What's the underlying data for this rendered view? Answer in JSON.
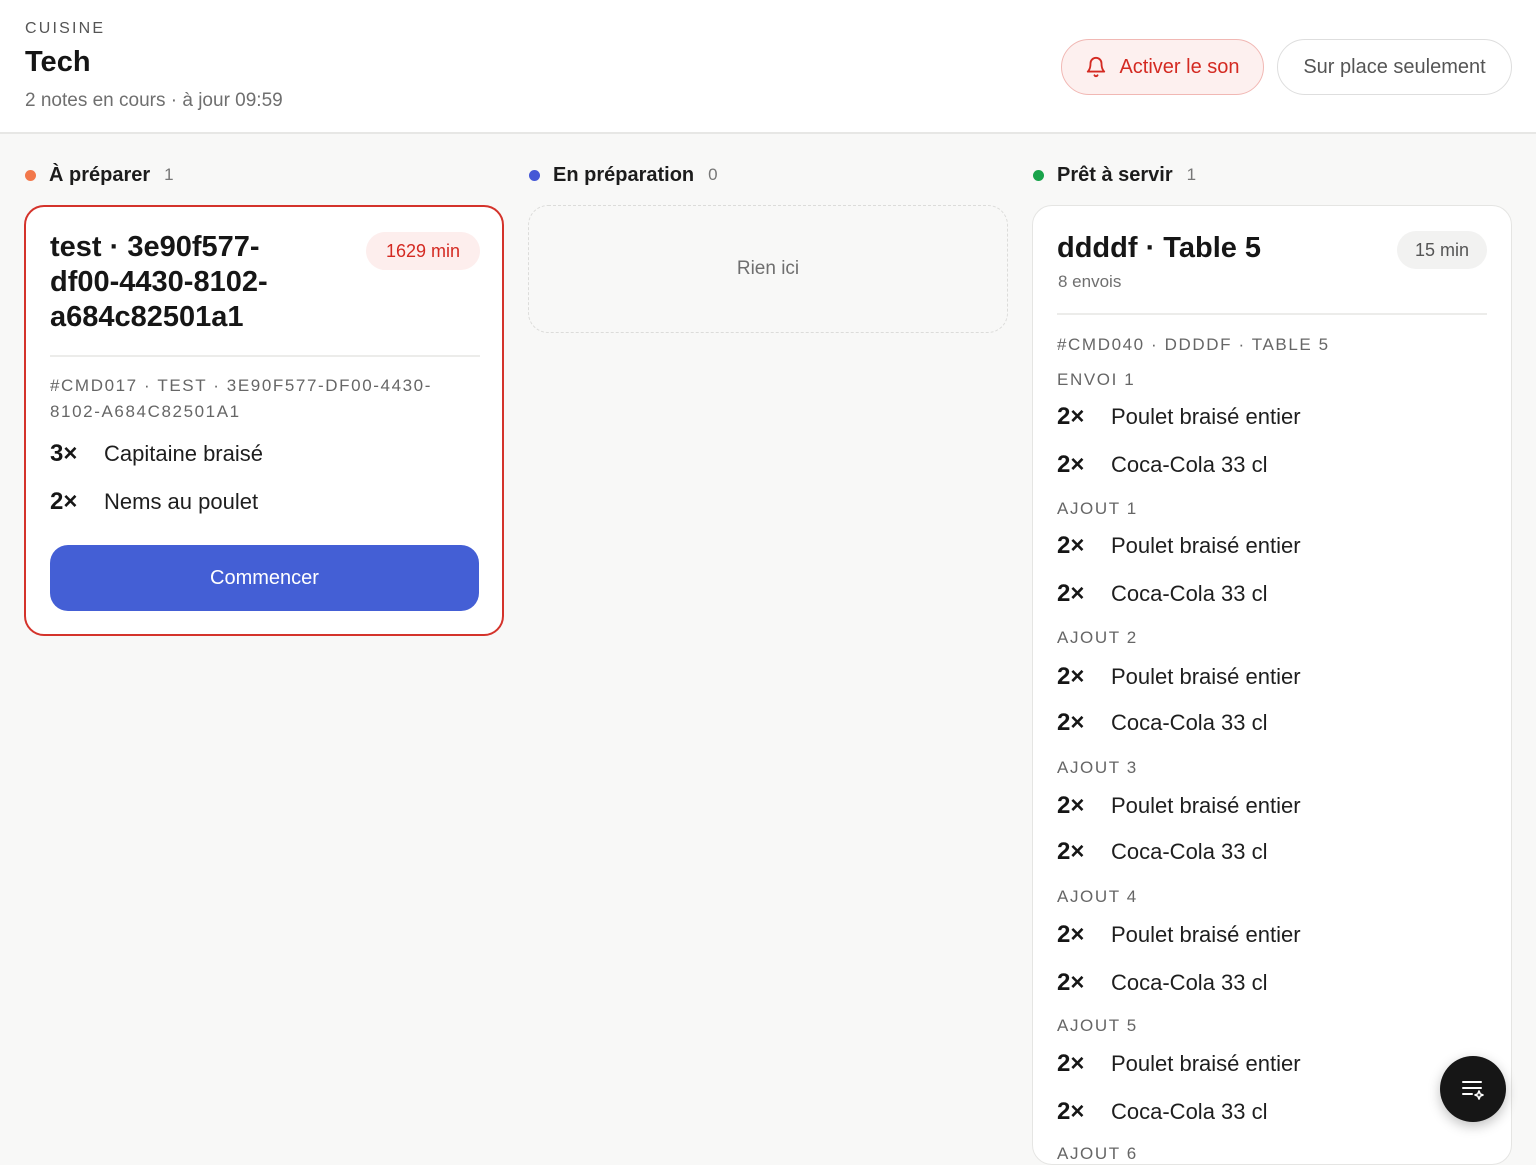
{
  "header": {
    "kicker": "CUISINE",
    "title": "Tech",
    "subtitle": "2 notes en cours · à jour 09:59",
    "sound_button": "Activer le son",
    "onsite_button": "Sur place seulement"
  },
  "colors": {
    "todo": "#f2784b",
    "in_progress": "#4558d6",
    "ready": "#19a34a",
    "late": "#d42a22",
    "primary": "#445fd5"
  },
  "columns": [
    {
      "title": "À préparer",
      "count": "1"
    },
    {
      "title": "En préparation",
      "count": "0"
    },
    {
      "title": "Prêt à servir",
      "count": "1"
    }
  ],
  "todo_card": {
    "title_line1": "test · 3e90f577-",
    "title_line2": "df00-4430-8102-",
    "title_line3": "a684c82501a1",
    "elapsed": "1629 min",
    "ref_line1": "#CMD017 · TEST · 3E90F577-DF00-4430-",
    "ref_line2": "8102-A684C82501A1",
    "items": [
      {
        "qty": "3×",
        "name": "Capitaine braisé"
      },
      {
        "qty": "2×",
        "name": "Nems au poulet"
      }
    ],
    "action": "Commencer"
  },
  "empty_text": "Rien ici",
  "ready_card": {
    "title": "ddddf · Table 5",
    "meta": "8 envois",
    "elapsed": "15 min",
    "ref": "#CMD040 · DDDDF · TABLE 5",
    "groups": [
      {
        "label": "ENVOI 1",
        "items": [
          {
            "qty": "2×",
            "name": "Poulet braisé entier"
          },
          {
            "qty": "2×",
            "name": "Coca-Cola 33 cl"
          }
        ]
      },
      {
        "label": "AJOUT 1",
        "items": [
          {
            "qty": "2×",
            "name": "Poulet braisé entier"
          },
          {
            "qty": "2×",
            "name": "Coca-Cola 33 cl"
          }
        ]
      },
      {
        "label": "AJOUT 2",
        "items": [
          {
            "qty": "2×",
            "name": "Poulet braisé entier"
          },
          {
            "qty": "2×",
            "name": "Coca-Cola 33 cl"
          }
        ]
      },
      {
        "label": "AJOUT 3",
        "items": [
          {
            "qty": "2×",
            "name": "Poulet braisé entier"
          },
          {
            "qty": "2×",
            "name": "Coca-Cola 33 cl"
          }
        ]
      },
      {
        "label": "AJOUT 4",
        "items": [
          {
            "qty": "2×",
            "name": "Poulet braisé entier"
          },
          {
            "qty": "2×",
            "name": "Coca-Cola 33 cl"
          }
        ]
      },
      {
        "label": "AJOUT 5",
        "items": [
          {
            "qty": "2×",
            "name": "Poulet braisé entier"
          },
          {
            "qty": "2×",
            "name": "Coca-Cola 33 cl"
          }
        ]
      },
      {
        "label": "AJOUT 6",
        "items": []
      }
    ]
  },
  "fab": {
    "icon": "list-sparkle-icon"
  }
}
